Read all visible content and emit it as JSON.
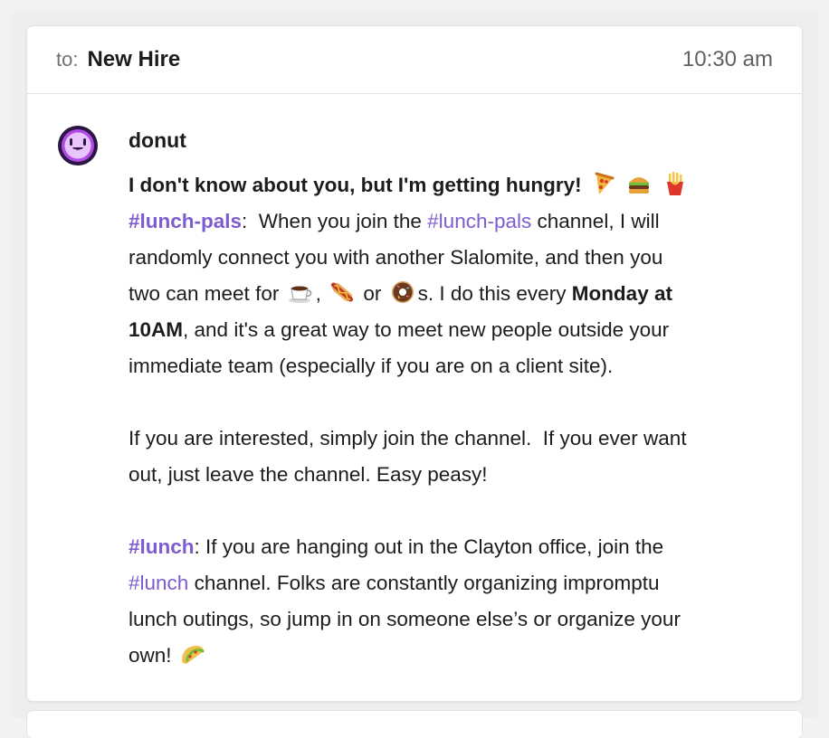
{
  "header": {
    "to_label": "to:",
    "recipient": "New Hire",
    "time": "10:30 am"
  },
  "message": {
    "sender": "donut",
    "avatar_icon": "donut-bot-icon",
    "avatar_color": "#b24ae6",
    "line1": {
      "bold": "I don't know about you, but I'm getting hungry!"
    },
    "line2": {
      "channel": "#lunch-pals",
      "sep": ":",
      "text_a": "  When you join the ",
      "channel_link": "#lunch-pals",
      "text_b": " channel, I will"
    },
    "line3": {
      "text": "randomly connect you with another Slalomite, and then you"
    },
    "line4": {
      "text_a": "two can meet for ",
      "comma": ",",
      "or": " or ",
      "text_b": "s. I do this every ",
      "bold": "Monday at"
    },
    "line5": {
      "bold": "10AM",
      "text": ", and it's a great way to meet new people outside your"
    },
    "line6": {
      "text": "immediate team (especially if you are on a client site)."
    },
    "line7": {
      "text": "If you are interested, simply join the channel.  If you ever want"
    },
    "line8": {
      "text": "out, just leave the channel. Easy peasy!"
    },
    "line9": {
      "channel": "#lunch",
      "text": ": If you are hanging out in the Clayton office, join the"
    },
    "line10": {
      "channel_link": "#lunch",
      "text": " channel. Folks are constantly organizing impromptu"
    },
    "line11": {
      "text": "lunch outings, so jump in on someone else’s or organize your"
    },
    "line12": {
      "text": "own! "
    },
    "emojis": [
      "pizza-icon",
      "burger-icon",
      "fries-icon",
      "coffee-icon",
      "hotdog-icon",
      "donut-icon",
      "taco-icon"
    ],
    "link_color": "#7d5bd0"
  }
}
